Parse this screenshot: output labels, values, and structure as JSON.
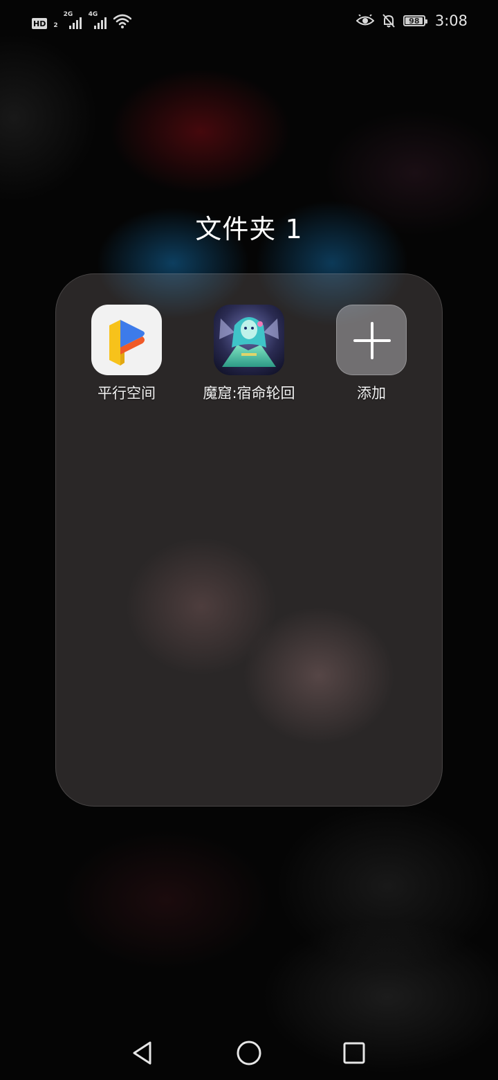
{
  "status_bar": {
    "hd_label": "HD",
    "hd_sub": "2",
    "net1_label": "2G",
    "net2_label": "4G",
    "battery_level": 98,
    "battery_text": "98",
    "time": "3:08"
  },
  "folder": {
    "title": "文件夹 1",
    "apps": [
      {
        "label": "平行空间",
        "icon": "parallel-space-icon"
      },
      {
        "label": "魔窟:宿命轮回",
        "icon": "game-app-icon"
      },
      {
        "label": "添加",
        "icon": "plus-icon"
      }
    ]
  },
  "nav_bar": {
    "back_icon": "triangle-back-icon",
    "home_icon": "circle-home-icon",
    "recents_icon": "square-recents-icon"
  },
  "colors": {
    "background": "#050505",
    "folder_panel": "#6b6464",
    "parallel_yellow": "#f7c21b",
    "parallel_blue": "#3d7bea",
    "parallel_orange": "#f05a28"
  }
}
